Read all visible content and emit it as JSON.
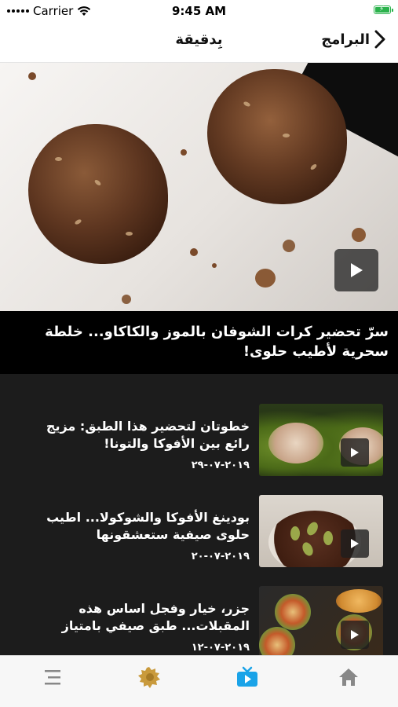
{
  "status_bar": {
    "carrier": "Carrier",
    "time": "9:45 AM",
    "battery_level": 1.0,
    "battery_color": "#2bb24c"
  },
  "nav": {
    "title": "بِدقيقة",
    "back_label": "البرامج",
    "back_icon": "chevron-right-icon"
  },
  "hero": {
    "caption": "سرّ تحضير كرات الشوفان بالموز والكاكاو... خلطة سحرية لأطيب حلوى!",
    "play_icon": "play-icon"
  },
  "videos": [
    {
      "title": "خطوتان لتحضير هذا الطبق: مزيج رائع بين الأفوكا والتونا!",
      "date": "٢٠١٩-٠٧-٢٩"
    },
    {
      "title": "بودينغ الأفوكا والشوكولا... اطيب حلوى صيفية ستعشقونها",
      "date": "٢٠١٩-٠٧-٢٠"
    },
    {
      "title": "جزر، خيار وفجل اساس هذه المقبلات... طبق صيفي بامتياز",
      "date": "٢٠١٩-٠٧-١٢"
    }
  ],
  "tab_bar": {
    "tabs": [
      {
        "icon": "menu-icon",
        "active": false
      },
      {
        "icon": "lion-logo-icon",
        "active": false
      },
      {
        "icon": "tv-icon",
        "active": true
      },
      {
        "icon": "home-icon",
        "active": false
      }
    ],
    "active_color": "#1aa3e8",
    "inactive_color": "#888888"
  }
}
